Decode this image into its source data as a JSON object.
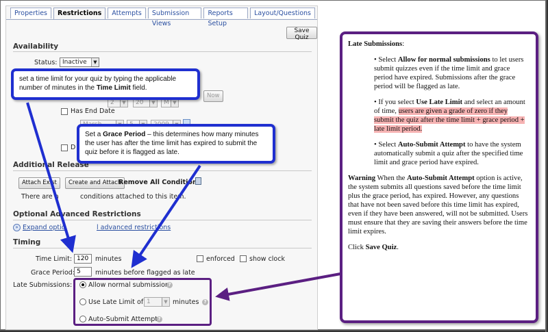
{
  "tabs": [
    "Properties",
    "Restrictions",
    "Attempts",
    "Submission Views",
    "Reports Setup",
    "Layout/Questions"
  ],
  "toolbar": {
    "save_label": "Save Quiz"
  },
  "availability": {
    "heading": "Availability",
    "status_label": "Status:",
    "status_value": "Inactive",
    "now_label": "Now",
    "start_day": "2",
    "start_year": "20",
    "end_checkbox_label": "Has End Date",
    "end_month": "March",
    "end_day": "5",
    "end_year": "2009",
    "end_mark": "M",
    "d_label": "D"
  },
  "release": {
    "heading": "Additional Release",
    "attach_existing": "Attach Exist",
    "create_attach": "Create and Attach",
    "remove_all": "Remove All Conditions",
    "no_conditions_prefix": "There are n",
    "no_conditions_suffix": "conditions attached to this item."
  },
  "optional": {
    "heading": "Optional Advanced Restrictions",
    "expand_link_a": "Expand optio",
    "expand_link_b": "l advanced restrictions"
  },
  "timing": {
    "heading": "Timing",
    "time_limit_label": "Time Limit:",
    "time_limit_value": "120",
    "minutes": "minutes",
    "enforced": "enforced",
    "show_clock": "show clock",
    "grace_label": "Grace Period:",
    "grace_value": "5",
    "grace_suffix": "minutes before flagged as late",
    "late_label": "Late Submissions:",
    "opt_normal": "Allow normal submission",
    "opt_late_limit": "Use Late Limit of",
    "late_limit_value": "1",
    "opt_late_minutes": "minutes",
    "opt_auto": "Auto-Submit Attempt"
  },
  "callouts": {
    "time_limit_a": "set a time limit for your quiz by typing the applicable number of minutes in the ",
    "time_limit_b": "Time Limit",
    "time_limit_c": " field.",
    "grace_a": "Set a ",
    "grace_b": "Grace Period",
    "grace_c": " – this determines how many minutes the user has after the time limit has expired to submit the quiz before it is flagged as late."
  },
  "panel": {
    "title_bold": "Late Submissions",
    "title_rest": ":",
    "b1_a": "• Select ",
    "b1_b": "Allow for normal submissions",
    "b1_c": " to let users submit quizzes even if the time limit and grace period have expired. Submissions after the grace period will be flagged as late.",
    "b2_a": "• If you select ",
    "b2_b": "Use Late Limit",
    "b2_c": " and select an amount of time, ",
    "b2_hl": "users are given a grade of zero if they submit the quiz after the time limit + grace period + late limit period.",
    "b3_a": "• Select ",
    "b3_b": "Auto-Submit Attempt",
    "b3_c": " to have the system automatically submit a quiz after the specified time limit and grace period have expired.",
    "warn_a": "Warning",
    "warn_b": " When the ",
    "warn_c": "Auto-Submit Attempt",
    "warn_d": " option is active, the system submits all questions saved before the time limit plus the grace period, has expired. However, any questions that have not been saved before this time limit has expired, even if they have been answered, will not be submitted. Users must ensure that they are saving their answers before the time limit expires.",
    "click_a": "Click ",
    "click_b": "Save Quiz",
    "click_c": "."
  },
  "colors": {
    "callout_border": "#1f2fd0",
    "panel_border": "#5b1f82",
    "highlight": "#f6b3b3",
    "link": "#2a4fa0"
  }
}
